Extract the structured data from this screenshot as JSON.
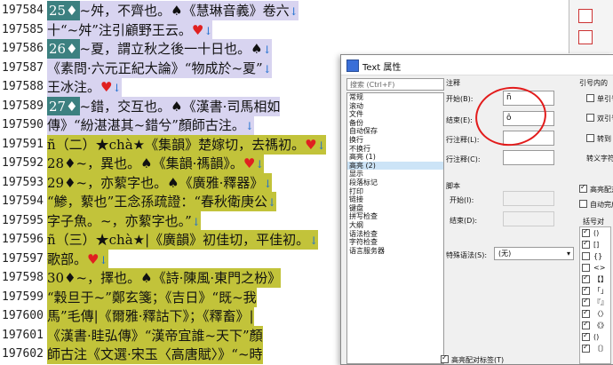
{
  "editor": {
    "lines": [
      {
        "num": "197584",
        "hl": "v",
        "parts": [
          {
            "k": "tag",
            "t": "25♦"
          },
          {
            "k": "t",
            "t": "~舛，不齊也。"
          },
          {
            "k": "club",
            "t": "♠"
          },
          {
            "k": "t",
            "t": "《慧琳音義》卷六"
          },
          {
            "k": "arr",
            "t": "↓"
          }
        ]
      },
      {
        "num": "197585",
        "hl": "v",
        "parts": [
          {
            "k": "t",
            "t": "十“~舛”注引顧野王云。"
          },
          {
            "k": "heart",
            "t": "♥"
          },
          {
            "k": "arr",
            "t": "↓"
          }
        ]
      },
      {
        "num": "197586",
        "hl": "v",
        "parts": [
          {
            "k": "tag",
            "t": "26♦"
          },
          {
            "k": "t",
            "t": "~夏，謂立秋之後一十日也。"
          },
          {
            "k": "club",
            "t": "♠"
          },
          {
            "k": "arr",
            "t": "↓"
          }
        ]
      },
      {
        "num": "197587",
        "hl": "v",
        "parts": [
          {
            "k": "t",
            "t": "《素問·六元正紀大論》“物成於~夏”"
          },
          {
            "k": "arr",
            "t": "↓"
          }
        ]
      },
      {
        "num": "197588",
        "hl": "v",
        "parts": [
          {
            "k": "t",
            "t": "王冰注。"
          },
          {
            "k": "heart",
            "t": "♥"
          },
          {
            "k": "arr",
            "t": "↓"
          }
        ]
      },
      {
        "num": "197589",
        "hl": "v",
        "parts": [
          {
            "k": "tag",
            "t": "27♦"
          },
          {
            "k": "t",
            "t": "~錯，交互也。"
          },
          {
            "k": "club",
            "t": "♠"
          },
          {
            "k": "t",
            "t": "《漢書·司馬相如"
          }
        ]
      },
      {
        "num": "197590",
        "hl": "v",
        "parts": [
          {
            "k": "t",
            "t": "傳》“紛湛湛其~錯兮”顏師古注。"
          },
          {
            "k": "arr",
            "t": "↓"
          }
        ]
      },
      {
        "num": "197591",
        "hl": "y",
        "parts": [
          {
            "k": "t",
            "t": "ñ（二）★chà★《集韻》楚嫁切，去禡初。"
          },
          {
            "k": "heart",
            "t": "♥"
          },
          {
            "k": "arr",
            "t": "↓"
          }
        ]
      },
      {
        "num": "197592",
        "hl": "y",
        "parts": [
          {
            "k": "t",
            "t": "28♦~，異也。"
          },
          {
            "k": "club",
            "t": "♠"
          },
          {
            "k": "t",
            "t": "《集韻·禡韻》。"
          },
          {
            "k": "heart",
            "t": "♥"
          },
          {
            "k": "arr",
            "t": "↓"
          }
        ]
      },
      {
        "num": "197593",
        "hl": "y",
        "parts": [
          {
            "k": "t",
            "t": "29♦~，亦蕠字也。"
          },
          {
            "k": "club",
            "t": "♠"
          },
          {
            "k": "t",
            "t": "《廣雅·釋器》"
          },
          {
            "k": "arr",
            "t": "↓"
          }
        ]
      },
      {
        "num": "197594",
        "hl": "y",
        "parts": [
          {
            "k": "t",
            "t": "“鯵，蕠也”王念孫疏證：“春秋衛庚公"
          },
          {
            "k": "arr",
            "t": "↓"
          }
        ]
      },
      {
        "num": "197595",
        "hl": "y",
        "parts": [
          {
            "k": "t",
            "t": "字子魚。~，亦蕠字也。”"
          },
          {
            "k": "arr",
            "t": "↓"
          }
        ]
      },
      {
        "num": "197596",
        "hl": "y",
        "parts": [
          {
            "k": "t",
            "t": "ñ（三）★chà★|《廣韻》初佳切，平佳初。"
          },
          {
            "k": "arr",
            "t": "↓"
          }
        ]
      },
      {
        "num": "197597",
        "hl": "y",
        "parts": [
          {
            "k": "t",
            "t": "歌部。"
          },
          {
            "k": "heart",
            "t": "♥"
          },
          {
            "k": "arr",
            "t": "↓"
          }
        ]
      },
      {
        "num": "197598",
        "hl": "y",
        "parts": [
          {
            "k": "t",
            "t": "30♦~，擇也。"
          },
          {
            "k": "club",
            "t": "♠"
          },
          {
            "k": "t",
            "t": "《詩·陳風·東門之枌》"
          }
        ]
      },
      {
        "num": "197599",
        "hl": "y",
        "parts": [
          {
            "k": "t",
            "t": "“穀旦于~”鄭玄箋；《吉日》“既~我"
          }
        ]
      },
      {
        "num": "197600",
        "hl": "y",
        "parts": [
          {
            "k": "t",
            "t": "馬”毛傳|《爾雅·釋詁下》；《釋畜》|"
          }
        ]
      },
      {
        "num": "197601",
        "hl": "y",
        "parts": [
          {
            "k": "t",
            "t": "《漢書·眭弘傳》“漢帝宜誰~天下”顏"
          }
        ]
      },
      {
        "num": "197602",
        "hl": "y",
        "parts": [
          {
            "k": "t",
            "t": "師古注《文選·宋玉〈高唐賦〉》“~時"
          }
        ]
      }
    ]
  },
  "dialog": {
    "title": "Text 属性",
    "search_placeholder": "搜索 (Ctrl+F)",
    "categories": [
      "常规",
      "滚动",
      "文件",
      "备份",
      "自动保存",
      "换行",
      "不换行",
      "高亮 (1)",
      "高亮 (2)",
      "显示",
      "段落标记",
      "打印",
      "链接",
      "键盘",
      "拼写检查",
      "大纲",
      "语法检查",
      "字符检查",
      "语言服务器"
    ],
    "selected_category": "高亮 (2)",
    "annot_group": "注释",
    "start_label": "开始(B):",
    "start_value": "ñ",
    "end_label": "结束(E):",
    "end_value": "ô",
    "line_annot_label": "行注释(L):",
    "line_annot_label2": "行注释(C):",
    "script_group": "脚本",
    "script_start": "开始(I):",
    "script_end": "结束(D):",
    "syntax_label": "特殊语法(S):",
    "syntax_value": "(无)",
    "quote_group": "引号内的",
    "quote_items": [
      "单引号",
      "双引号",
      "转到"
    ],
    "escape_label": "转义字符",
    "hl_pair_label": "高亮配对",
    "auto_complete_label": "自动完成",
    "bracket_header": "括号对",
    "brackets": [
      "()",
      "[]",
      "{}",
      "<>",
      "【】",
      "「」",
      "『』",
      "〈〉",
      "《》",
      "()",
      "〔〕"
    ],
    "bracket_checked": [
      true,
      true,
      false,
      false,
      true,
      true,
      true,
      true,
      true,
      true,
      true
    ],
    "bottom_check_label": "高亮配对标签(T)"
  }
}
